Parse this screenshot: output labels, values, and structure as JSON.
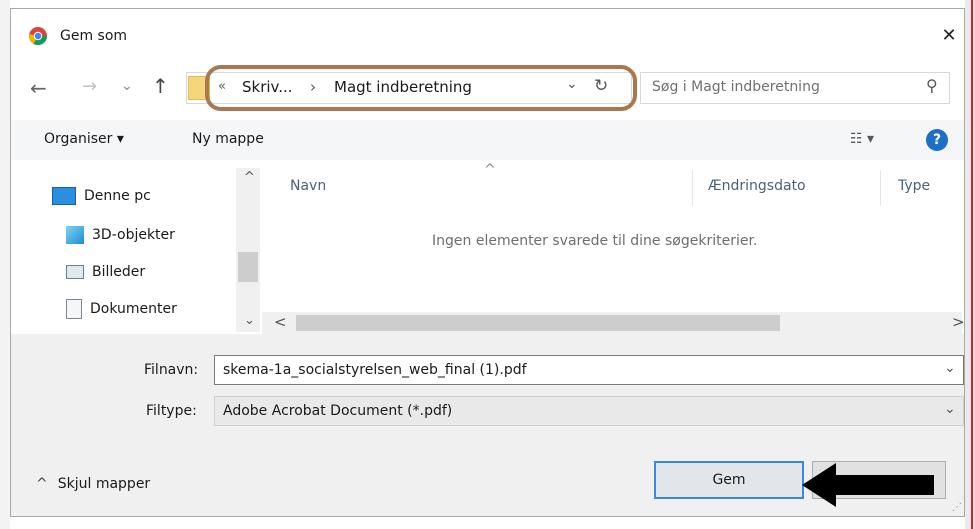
{
  "window": {
    "title": "Gem som",
    "close_glyph": "✕"
  },
  "nav": {
    "back_glyph": "←",
    "forward_glyph": "→",
    "recent_glyph": "⌄",
    "up_glyph": "↑",
    "chevron_left": "«",
    "breadcrumb": [
      "Skriv...",
      "Magt indberetning"
    ],
    "breadcrumb_sep": "›",
    "dropdown_glyph": "⌄",
    "refresh_glyph": "↻",
    "search_placeholder": "Søg i Magt indberetning",
    "search_glyph": "⚲"
  },
  "toolbar": {
    "organise": "Organiser ▾",
    "new_folder": "Ny mappe",
    "view_glyph": "☷ ▾",
    "help_glyph": "?"
  },
  "sidebar": {
    "items": [
      {
        "label": "Denne pc",
        "icon": "computer-icon"
      },
      {
        "label": "3D-objekter",
        "icon": "cube-icon"
      },
      {
        "label": "Billeder",
        "icon": "pictures-icon"
      },
      {
        "label": "Dokumenter",
        "icon": "documents-icon"
      }
    ],
    "scroll_up": "^",
    "scroll_down": "⌄"
  },
  "file_list": {
    "sort_glyph": "^",
    "columns": [
      "Navn",
      "Ændringsdato",
      "Type"
    ],
    "empty_message": "Ingen elementer svarede til dine søgekriterier.",
    "hscroll_left": "<",
    "hscroll_right": ">"
  },
  "form": {
    "filename_label": "Filnavn:",
    "filename_value": "skema-1a_socialstyrelsen_web_final (1).pdf",
    "filetype_label": "Filtype:",
    "filetype_value": "Adobe Acrobat Document (*.pdf)",
    "dropdown_glyph": "⌄"
  },
  "footer": {
    "hide_folders": "Skjul mapper",
    "hide_glyph": "^",
    "save_button": "Gem",
    "cancel_button": ""
  },
  "colors": {
    "highlight_oval": "#a87850",
    "primary_border": "#3c8ad6",
    "help_blue": "#1e6fc8",
    "arrow": "#000000"
  }
}
